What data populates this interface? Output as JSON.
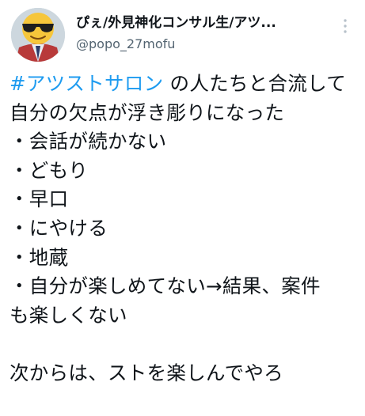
{
  "tweet": {
    "author": {
      "display_name": "ぴぇ/外見神化コンサル生/アツ...",
      "handle": "@popo_27mofu",
      "avatar_icon": "sunglasses-emoji-avatar-icon"
    },
    "more_icon": "more-vertical-icon",
    "body": {
      "hashtag": "#アツストサロン",
      "text": " の人たちと合流して自分の欠点が浮き彫りになった\n・会話が続かない\n・どもり\n・早口\n・にやける\n・地蔵\n・自分が楽しめてない→結果、案件　も楽しくない\n\n次からは、ストを楽しんでやろ"
    },
    "colors": {
      "hashtag": "#1d9bf0",
      "text": "#0f1419",
      "secondary": "#536471"
    }
  }
}
